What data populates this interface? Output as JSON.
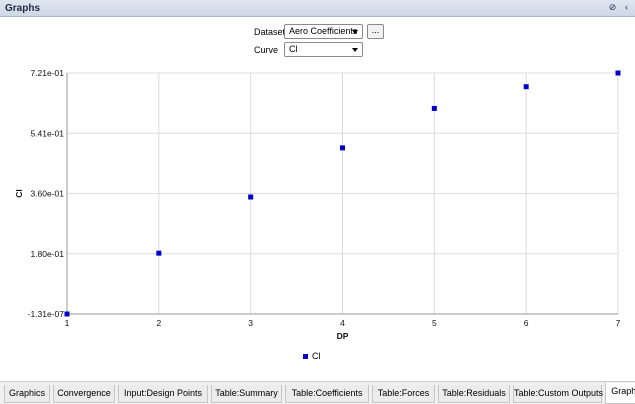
{
  "window": {
    "title": "Graphs",
    "icons": [
      "pin-icon",
      "collapse-icon"
    ]
  },
  "controls": {
    "dataset_label": "Dataset",
    "dataset_value": "Aero Coefficients",
    "more_button": "...",
    "curve_label": "Curve",
    "curve_value": "Cl"
  },
  "chart_data": {
    "type": "scatter",
    "xlabel": "DP",
    "ylabel": "Cl",
    "xlim": [
      1,
      7
    ],
    "ylim": [
      -1.31e-07,
      0.721
    ],
    "x_ticks": [
      "1",
      "2",
      "3",
      "4",
      "5",
      "6",
      "7"
    ],
    "y_ticks": [
      "-1.31e-07",
      "1.80e-01",
      "3.60e-01",
      "5.41e-01",
      "7.21e-01"
    ],
    "grid": true,
    "legend": "bottom-center",
    "series": [
      {
        "name": "Cl",
        "color": "#0000c8",
        "x": [
          1,
          2,
          3,
          4,
          5,
          6,
          7
        ],
        "y": [
          0.0,
          0.182,
          0.35,
          0.497,
          0.615,
          0.68,
          0.721
        ]
      }
    ]
  },
  "tabs": {
    "items": [
      "Graphics",
      "Convergence",
      "Input:Design Points",
      "Table:Summary",
      "Table:Coefficients",
      "Table:Forces",
      "Table:Residuals",
      "Table:Custom Outputs",
      "Graphs"
    ],
    "active": "Graphs"
  }
}
